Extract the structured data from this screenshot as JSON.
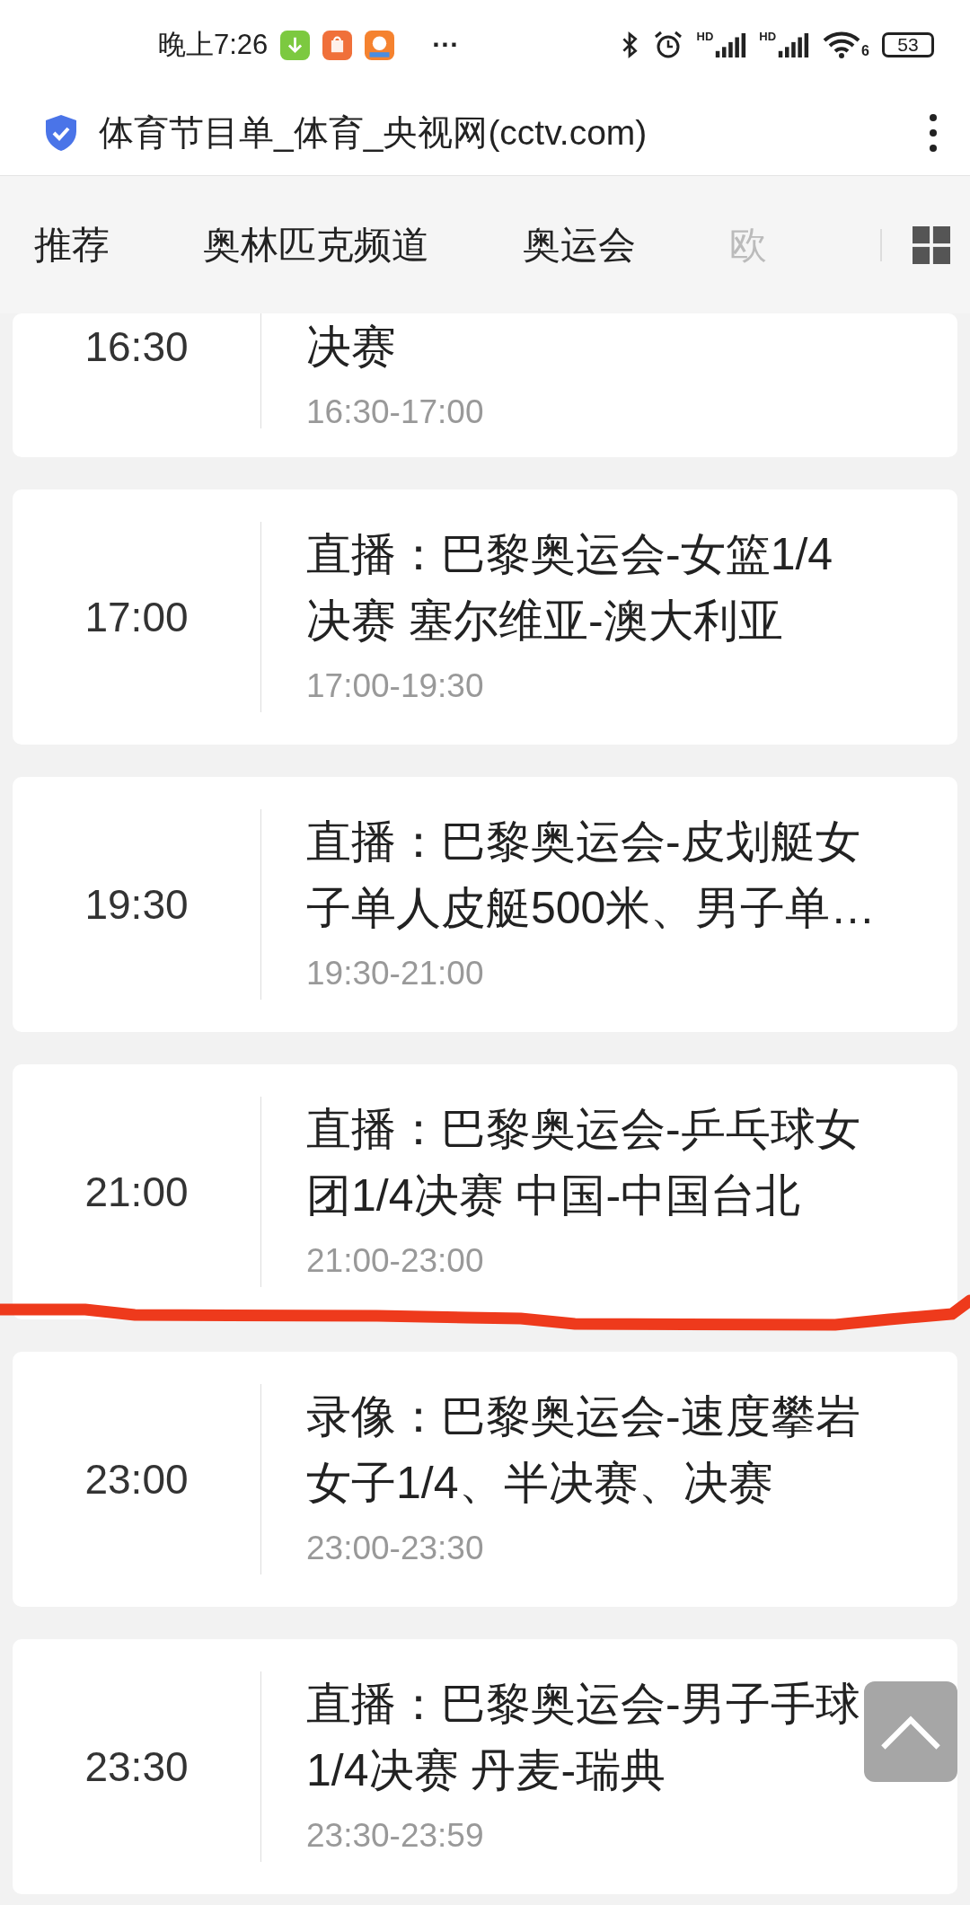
{
  "status_bar": {
    "time": "晚上7:26",
    "more": "···",
    "signal_labels": [
      "HD",
      "HD"
    ],
    "wifi_label": "6",
    "battery": "53"
  },
  "browser_bar": {
    "title": "体育节目单_体育_央视网(cctv.com)"
  },
  "tabs": [
    {
      "label": "推荐",
      "faded": false
    },
    {
      "label": "奥林匹克频道",
      "faded": false
    },
    {
      "label": "奥运会",
      "faded": false
    },
    {
      "label": "欧",
      "faded": true
    }
  ],
  "programs": [
    {
      "time": "16:30",
      "title": "决赛",
      "range": "16:30-17:00",
      "partial": true
    },
    {
      "time": "17:00",
      "title": "直播：巴黎奥运会-女篮1/4决赛 塞尔维亚-澳大利亚",
      "range": "17:00-19:30",
      "partial": false
    },
    {
      "time": "19:30",
      "title": "直播：巴黎奥运会-皮划艇女子单人皮艇500米、男子单…",
      "range": "19:30-21:00",
      "partial": false
    },
    {
      "time": "21:00",
      "title": "直播：巴黎奥运会-乒乓球女团1/4决赛 中国-中国台北",
      "range": "21:00-23:00",
      "partial": false
    },
    {
      "time": "23:00",
      "title": "录像：巴黎奥运会-速度攀岩女子1/4、半决赛、决赛",
      "range": "23:00-23:30",
      "partial": false
    },
    {
      "time": "23:30",
      "title": "直播：巴黎奥运会-男子手球1/4决赛 丹麦-瑞典",
      "range": "23:30-23:59",
      "partial": false
    }
  ]
}
